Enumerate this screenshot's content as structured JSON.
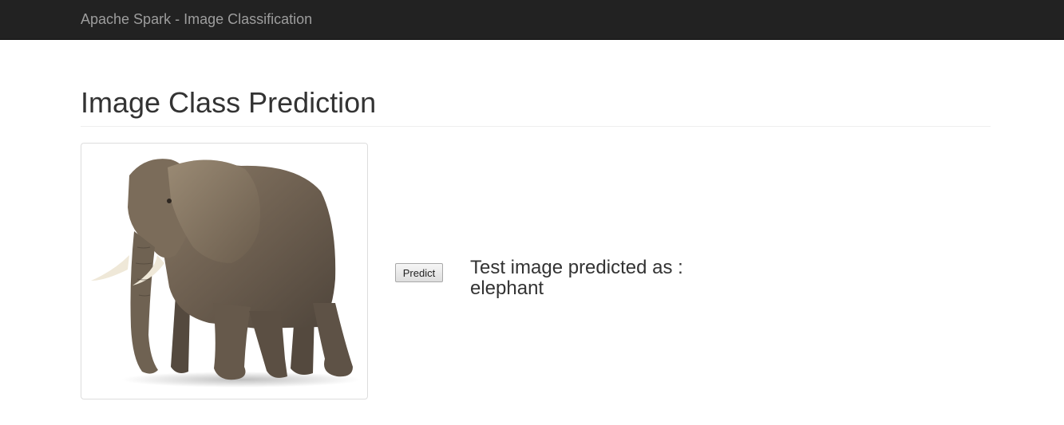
{
  "navbar": {
    "brand": "Apache Spark - Image Classification"
  },
  "main": {
    "title": "Image Class Prediction",
    "image": {
      "subject": "elephant"
    },
    "predict_button_label": "Predict",
    "result": {
      "prefix": "Test image predicted as :",
      "value": "elephant"
    }
  },
  "colors": {
    "navbar_bg": "#222222",
    "brand_text": "#9d9d9d",
    "body_text": "#333333"
  }
}
